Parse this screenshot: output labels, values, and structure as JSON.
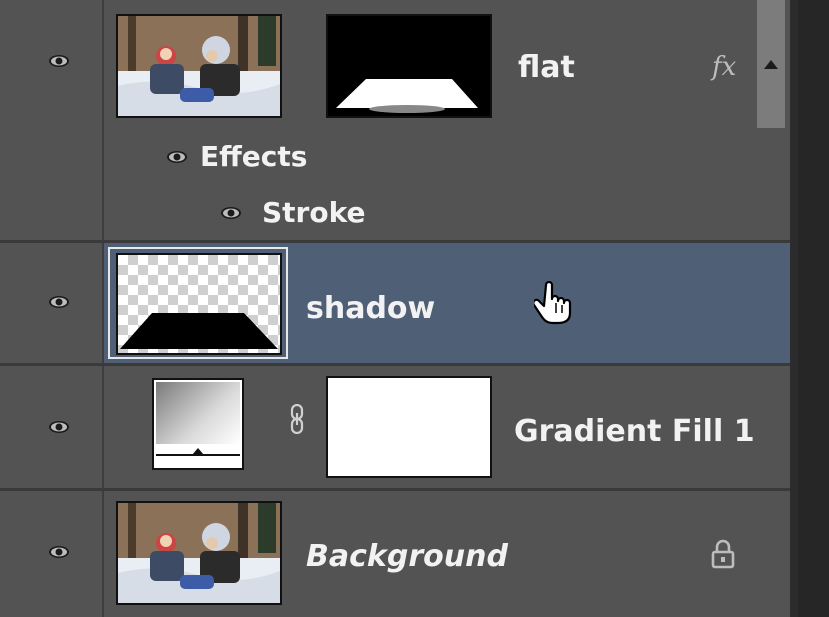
{
  "layers": {
    "flat": {
      "name": "flat",
      "fx_label": "fx"
    },
    "effects": {
      "label": "Effects"
    },
    "stroke": {
      "label": "Stroke"
    },
    "shadow": {
      "name": "shadow"
    },
    "gradient": {
      "name": "Gradient Fill 1"
    },
    "background": {
      "name": "Background"
    }
  },
  "colors": {
    "panel": "#535353",
    "selected": "#4f6076",
    "text": "#f2f2f2"
  },
  "icons": {
    "visibility": "eye-icon",
    "link": "chain-link-icon",
    "lock": "lock-icon",
    "fx": "fx-icon",
    "cursor": "hand-pointer-icon"
  }
}
